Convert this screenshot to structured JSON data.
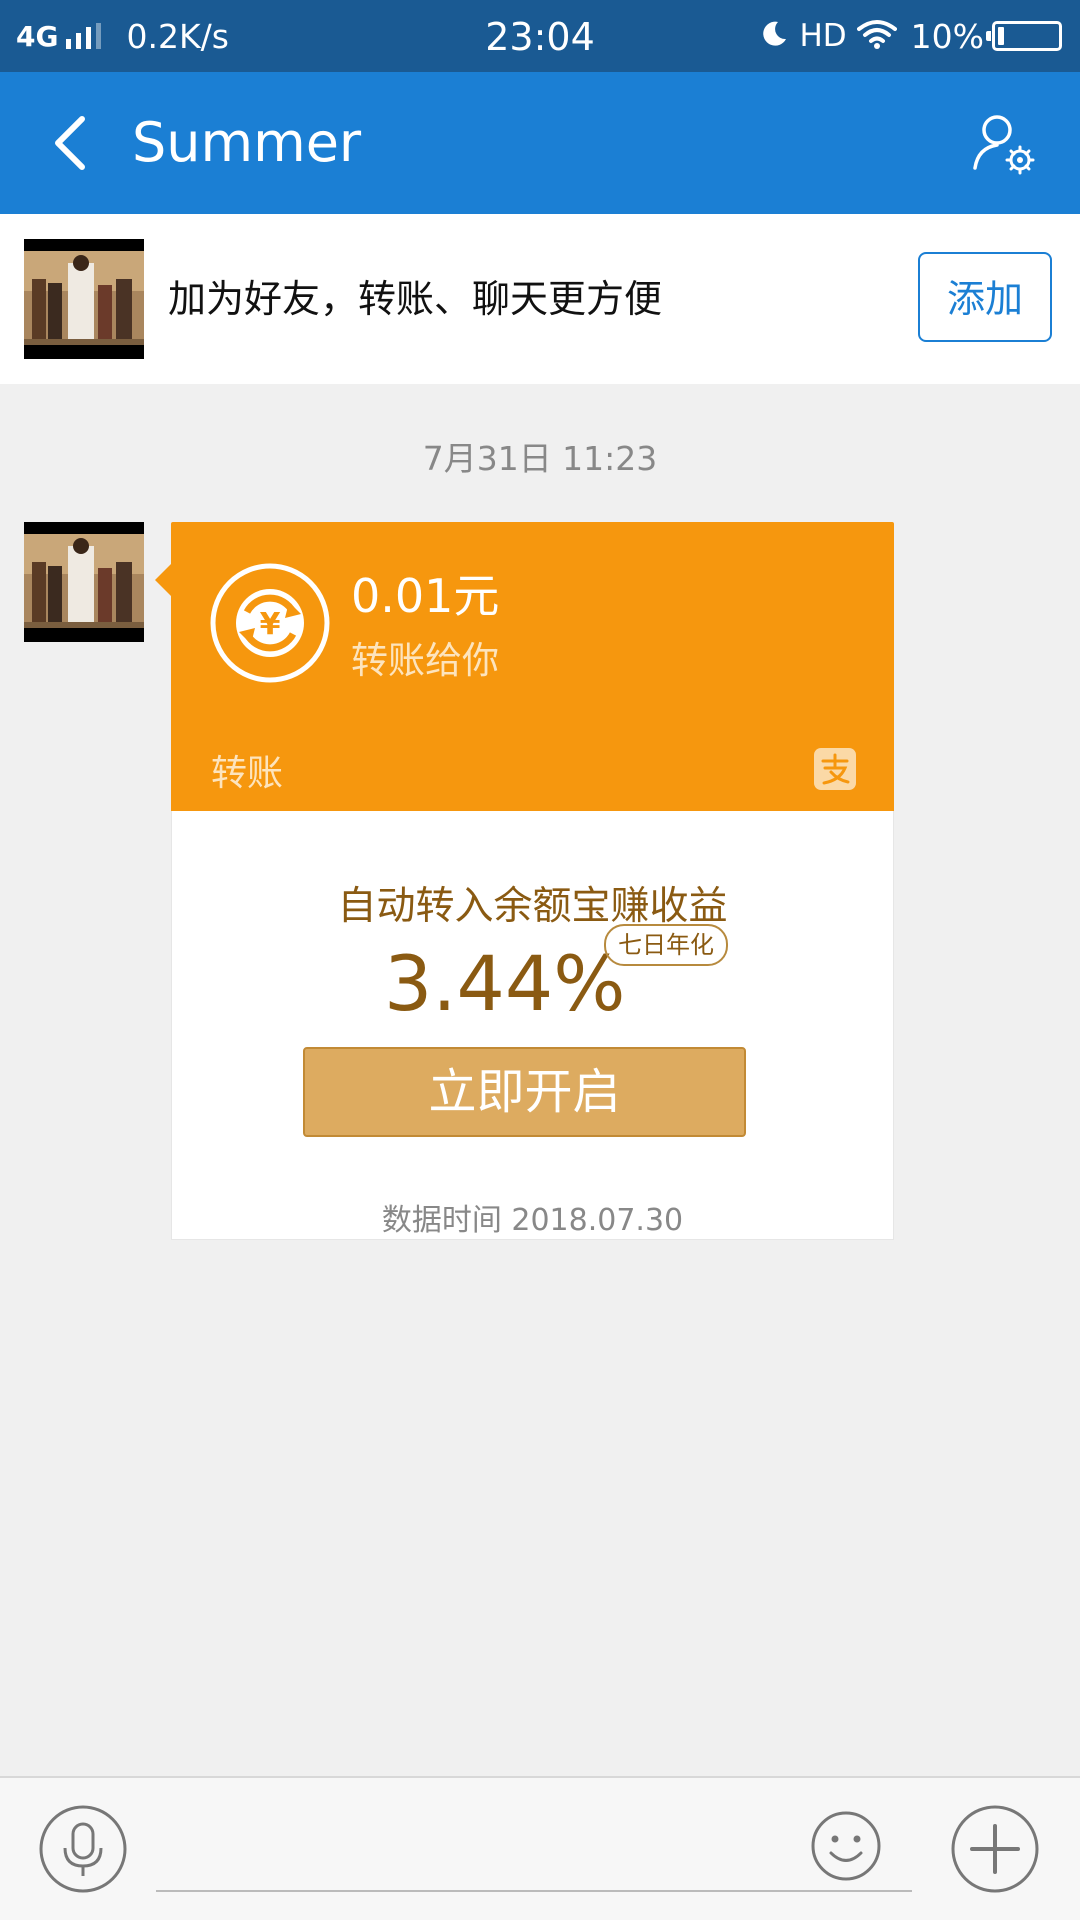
{
  "status_bar": {
    "network": "4G",
    "speed": "0.2K/s",
    "time": "23:04",
    "hd": "HD",
    "battery": "10%"
  },
  "header": {
    "title": "Summer"
  },
  "friend_banner": {
    "text": "加为好友，转账、聊天更方便",
    "add_label": "添加"
  },
  "chat": {
    "timestamp": "7月31日 11:23",
    "transfer_card": {
      "amount": "0.01元",
      "subtitle": "转账给你",
      "label": "转账",
      "promo_title": "自动转入余额宝赚收益",
      "rate": "3.44%",
      "rate_badge": "七日年化",
      "open_button": "立即开启",
      "data_time": "数据时间 2018.07.30"
    }
  },
  "input_bar": {
    "text_value": ""
  },
  "colors": {
    "status_bar": "#1a5a93",
    "header": "#1b7fd4",
    "card_orange": "#f6970e",
    "gold_text": "#8a5a12",
    "gold_button": "#ddab60"
  }
}
